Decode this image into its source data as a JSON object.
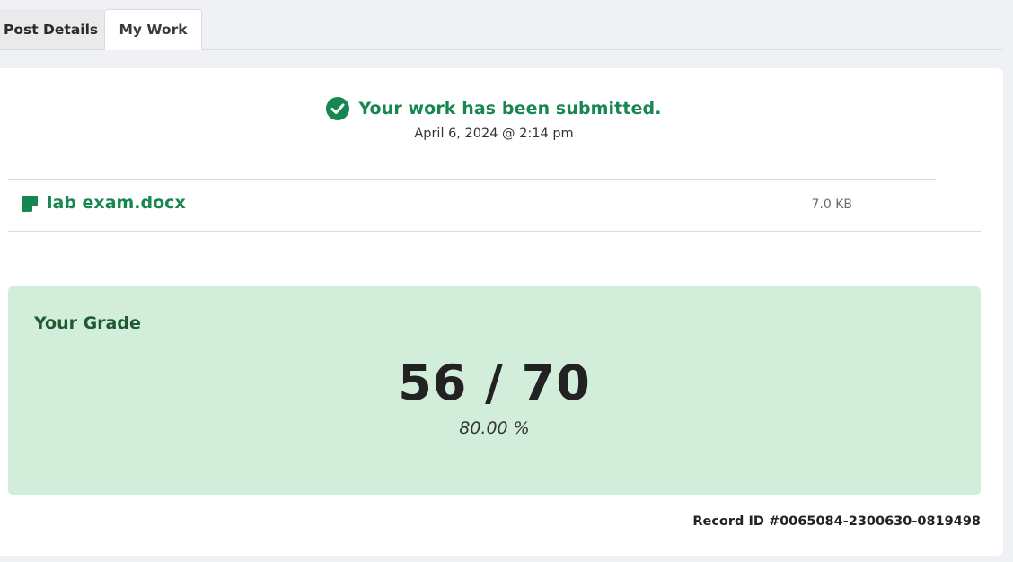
{
  "tabs": [
    {
      "label": "Post Details",
      "active": false
    },
    {
      "label": "My Work",
      "active": true
    }
  ],
  "submission": {
    "status": "Your work has been submitted.",
    "date": "April 6, 2024 @ 2:14 pm",
    "status_color": "#17874f",
    "icon": "check-circle-icon"
  },
  "file": {
    "name": "lab exam.docx",
    "size": "7.0 KB",
    "icon": "document-icon"
  },
  "grade": {
    "title": "Your Grade",
    "score": "56 / 70",
    "percent": "80.00 %",
    "background_color": "#d2eedb"
  },
  "record": {
    "id_text": "Record ID #0065084-2300630-0819498"
  }
}
